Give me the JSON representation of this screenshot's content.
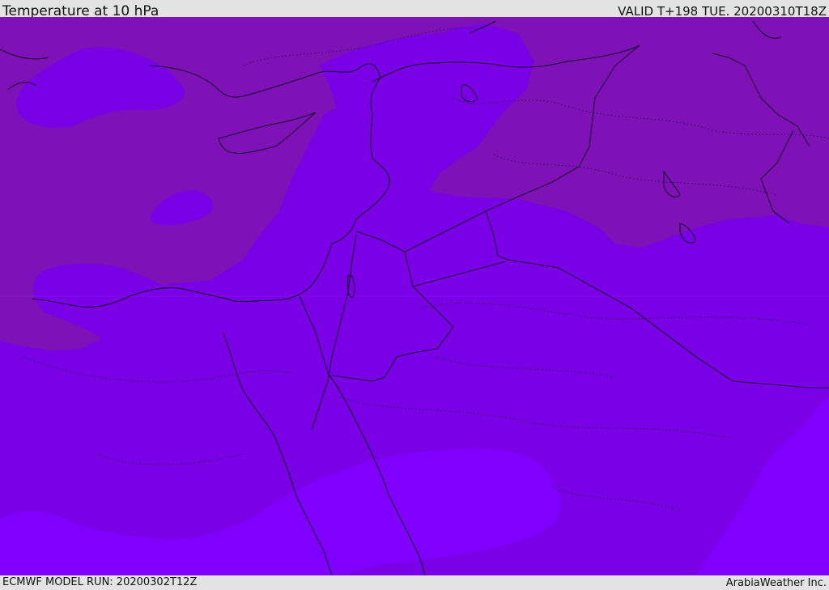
{
  "header": {
    "title": "Temperature at 10 hPa",
    "valid": "VALID T+198 TUE. 20200310T18Z"
  },
  "footer": {
    "model_run": "ECMWF MODEL RUN: 20200302T12Z",
    "credit": "ArabiaWeather Inc."
  },
  "colors": {
    "band_warm": "#7e12b6",
    "band_mid": "#7a00e6",
    "band_cool": "#8000ff",
    "coastline": "#1a0a2a",
    "border": "#1f0a36",
    "contour": "#2a0a4a",
    "chrome": "#e3e3e3"
  }
}
